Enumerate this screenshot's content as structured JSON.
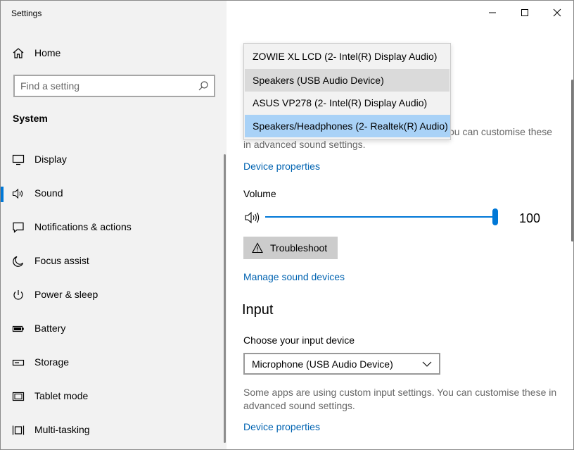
{
  "window": {
    "title": "Settings"
  },
  "sidebar": {
    "home_label": "Home",
    "search_placeholder": "Find a setting",
    "section_title": "System",
    "items": [
      {
        "label": "Display",
        "icon": "monitor-icon"
      },
      {
        "label": "Sound",
        "icon": "speaker-icon",
        "active": true
      },
      {
        "label": "Notifications & actions",
        "icon": "notification-icon"
      },
      {
        "label": "Focus assist",
        "icon": "moon-icon"
      },
      {
        "label": "Power & sleep",
        "icon": "power-icon"
      },
      {
        "label": "Battery",
        "icon": "battery-icon"
      },
      {
        "label": "Storage",
        "icon": "storage-icon"
      },
      {
        "label": "Tablet mode",
        "icon": "tablet-icon"
      },
      {
        "label": "Multi-tasking",
        "icon": "multitasking-icon"
      }
    ]
  },
  "output": {
    "dropdown_options": [
      "ZOWIE XL LCD (2- Intel(R) Display Audio)",
      "Speakers (USB Audio Device)",
      "ASUS VP278 (2- Intel(R) Display Audio)",
      "Speakers/Headphones (2- Realtek(R) Audio)"
    ],
    "help_text_line1": "ou can customise these",
    "help_text_line2": "in advanced sound settings.",
    "device_properties_label": "Device properties",
    "volume_label": "Volume",
    "volume_value": "100",
    "volume_level": 100,
    "troubleshoot_label": "Troubleshoot",
    "manage_devices_label": "Manage sound devices"
  },
  "input": {
    "heading": "Input",
    "choose_label": "Choose your input device",
    "selected_device": "Microphone (USB Audio Device)",
    "help_text_line1": "Some apps are using custom input settings. You can customise these in",
    "help_text_line2": "advanced sound settings.",
    "device_properties_label": "Device properties"
  },
  "colors": {
    "accent": "#0078d7",
    "link": "#0063b1",
    "sidebar_bg": "#f2f2f2",
    "selected_option": "#a9d2f7"
  }
}
